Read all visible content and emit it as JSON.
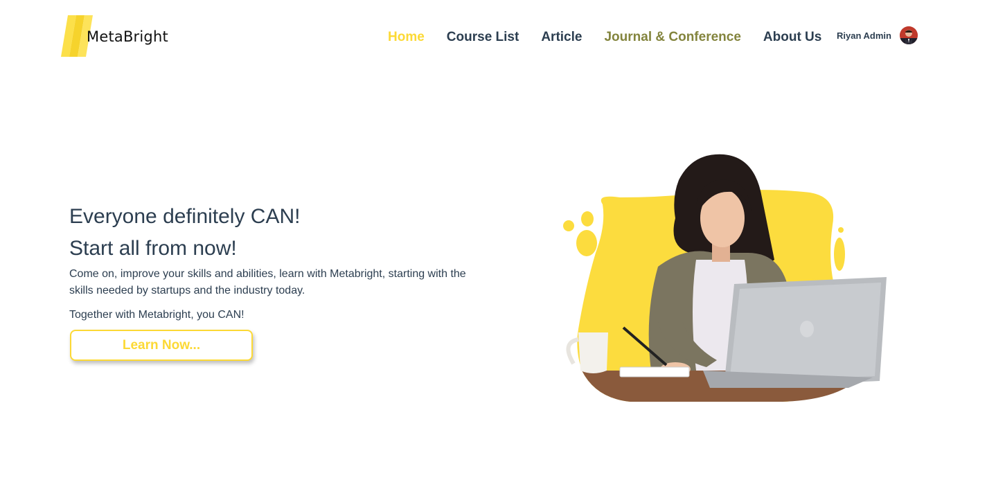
{
  "brand": {
    "name": "MetaBright",
    "logo_icon": "logo-stripes-icon",
    "accent_color": "#fcd935"
  },
  "nav": {
    "items": [
      {
        "label": "Home",
        "state": "active"
      },
      {
        "label": "Course List",
        "state": "normal"
      },
      {
        "label": "Article",
        "state": "normal"
      },
      {
        "label": "Journal & Conference",
        "state": "hover"
      },
      {
        "label": "About Us",
        "state": "normal"
      }
    ]
  },
  "user": {
    "name": "Riyan Admin"
  },
  "hero": {
    "title_line1": "Everyone definitely CAN!",
    "title_line2": "Start all from now!",
    "description": "Come on, improve your skills and abilities, learn with Metabright, starting with the skills needed by startups and the industry today.",
    "tagline": "Together with Metabright, you CAN!",
    "cta_label": "Learn Now..."
  },
  "colors": {
    "text": "#2c3e50",
    "nav_active": "#fcd935",
    "nav_hover": "#83843d"
  }
}
